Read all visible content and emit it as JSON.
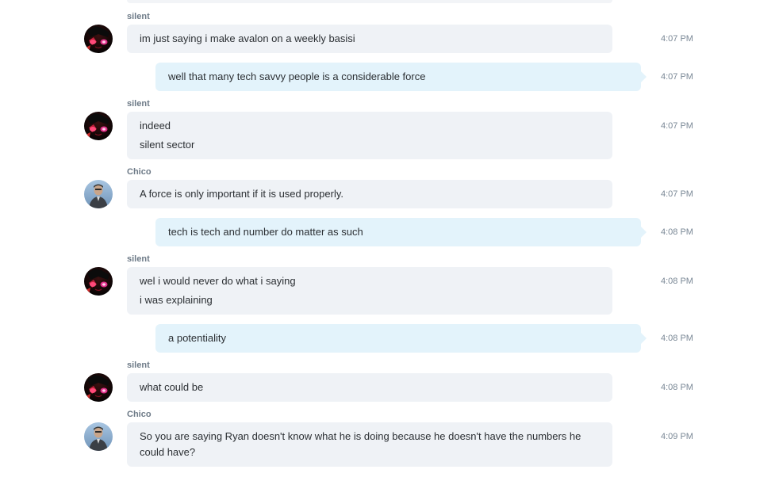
{
  "conversation": {
    "messages": [
      {
        "sender": "silent",
        "lines": [
          "im just saying i make avalon on a weekly basisi"
        ],
        "time": "4:07 PM"
      },
      {
        "sender": "",
        "lines": [
          "well that many tech savvy people is a considerable force"
        ],
        "time": "4:07 PM"
      },
      {
        "sender": "silent",
        "lines": [
          "indeed",
          "silent sector"
        ],
        "time": "4:07 PM"
      },
      {
        "sender": "Chico",
        "lines": [
          "A force is only important if it is used properly."
        ],
        "time": "4:07 PM"
      },
      {
        "sender": "",
        "lines": [
          "tech is tech and number do matter as such"
        ],
        "time": "4:08 PM"
      },
      {
        "sender": "silent",
        "lines": [
          "wel i would never do what i saying",
          "i was explaining"
        ],
        "time": "4:08 PM"
      },
      {
        "sender": "",
        "lines": [
          "a potentiality"
        ],
        "time": "4:08 PM"
      },
      {
        "sender": "silent",
        "lines": [
          "what could be"
        ],
        "time": "4:08 PM"
      },
      {
        "sender": "Chico",
        "lines": [
          "So you are saying Ryan doesn't know what he is doing because he doesn't have the numbers he could have?"
        ],
        "time": "4:09 PM"
      }
    ]
  },
  "colors": {
    "incoming_bubble": "#eff2f6",
    "outgoing_bubble": "#e3f3fb",
    "sender_name": "#6d7a87",
    "timestamp": "#7a8896"
  },
  "icons": {
    "silent_avatar": "dark-anime-avatar-icon",
    "chico_avatar": "person-photo-avatar-icon"
  }
}
